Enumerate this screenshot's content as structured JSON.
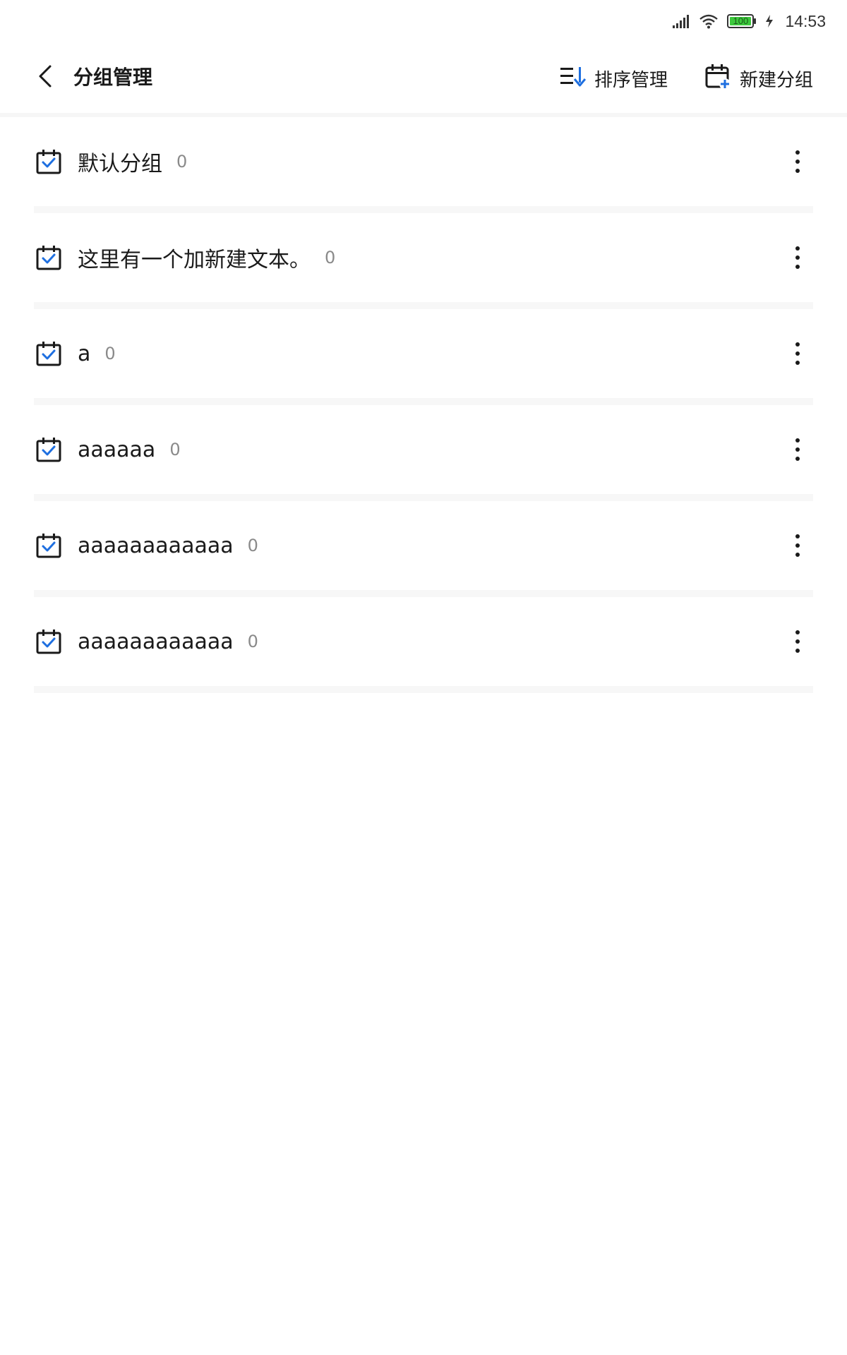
{
  "status_bar": {
    "time": "14:53",
    "battery_level": "100",
    "icons": [
      "signal-icon",
      "wifi-icon",
      "battery-icon",
      "charging-icon"
    ]
  },
  "header": {
    "back_icon": "chevron-left-icon",
    "title": "分组管理",
    "sort_label": "排序管理",
    "sort_icon": "sort-list-icon",
    "new_group_label": "新建分组",
    "new_group_icon": "calendar-add-icon"
  },
  "groups": [
    {
      "name": "默认分组",
      "count": "0"
    },
    {
      "name": "这里有一个加新建文本。",
      "count": "0"
    },
    {
      "name": "a",
      "count": "0"
    },
    {
      "name": "aaaaaa",
      "count": "0"
    },
    {
      "name": "aaaaaaaaaaaa",
      "count": "0"
    },
    {
      "name": "aaaaaaaaaaaa",
      "count": "0"
    }
  ],
  "colors": {
    "accent": "#1e6fe0",
    "icon_dark": "#1a1a1a",
    "count_gray": "#8a8a8a",
    "divider": "#f7f7f7",
    "battery_green": "#3cc83c"
  }
}
